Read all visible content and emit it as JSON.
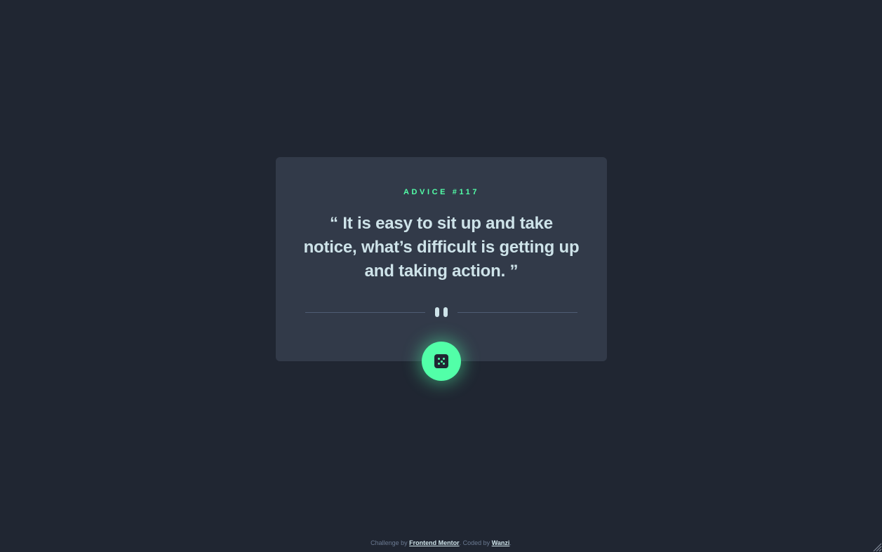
{
  "card": {
    "label": "ADVICE #117",
    "quote": "“ It is easy to sit up and take notice, what’s difficult is getting up and taking action. ”"
  },
  "action": {
    "icon": "dice-icon"
  },
  "footer": {
    "prefix": "Challenge by ",
    "link1": "Frontend Mentor",
    "middle": ". Coded by ",
    "link2": "Wanzi",
    "suffix": "."
  },
  "colors": {
    "background": "#202632",
    "card": "#323a49",
    "accent": "#52ffa8",
    "text": "#cee3e9",
    "divider": "#4f5d74"
  }
}
